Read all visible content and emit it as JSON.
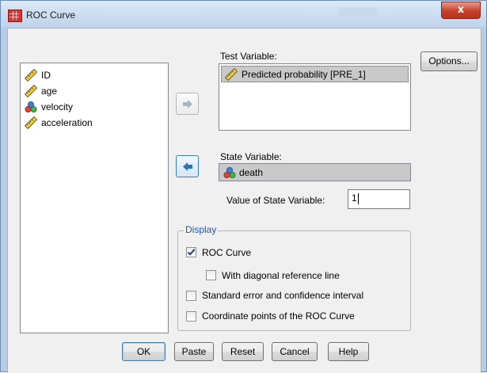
{
  "window": {
    "title": "ROC Curve",
    "close_glyph": "x",
    "app_icon": "spss-grid-icon"
  },
  "source_list": {
    "items": [
      {
        "label": "ID",
        "icon": "scale-ruler-icon"
      },
      {
        "label": "age",
        "icon": "scale-ruler-icon"
      },
      {
        "label": "velocity",
        "icon": "nominal-circles-icon"
      },
      {
        "label": "acceleration",
        "icon": "scale-ruler-icon"
      }
    ]
  },
  "test_variable": {
    "label": "Test Variable:",
    "items": [
      {
        "label": "Predicted probability [PRE_1]",
        "icon": "scale-ruler-icon"
      }
    ]
  },
  "state_variable": {
    "label": "State Variable:",
    "value": "death",
    "icon": "nominal-circles-icon"
  },
  "value_of_state": {
    "label": "Value of State Variable:",
    "value": "1"
  },
  "display_group": {
    "legend": "Display",
    "roc_curve": {
      "label": "ROC Curve",
      "checked": true
    },
    "diagonal": {
      "label": "With diagonal reference line",
      "checked": false
    },
    "std_error": {
      "label": "Standard error and confidence interval",
      "checked": false
    },
    "coordinates": {
      "label": "Coordinate points of the ROC Curve",
      "checked": false
    }
  },
  "buttons": {
    "options": "Options...",
    "ok": "OK",
    "paste": "Paste",
    "reset": "Reset",
    "cancel": "Cancel",
    "help": "Help"
  },
  "colors": {
    "window_frame": "#b7cde4",
    "dialog_bg": "#f0f0f0",
    "group_legend": "#1d5aa7",
    "close_button": "#c7402b",
    "selection": "#c9c9c9"
  }
}
